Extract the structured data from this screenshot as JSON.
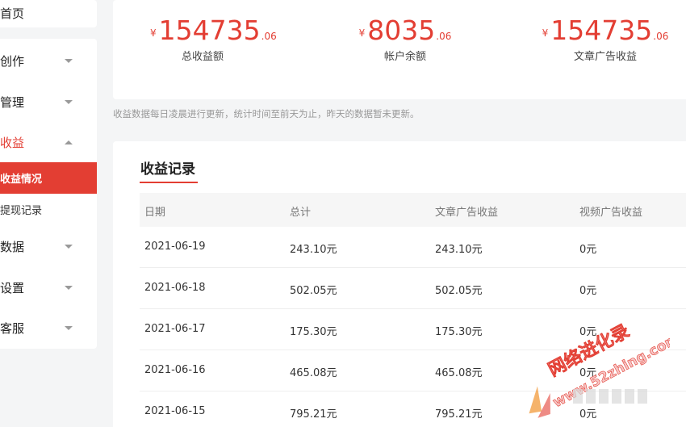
{
  "sidebar": {
    "home": "首页",
    "items": [
      {
        "label": "创作"
      },
      {
        "label": "管理"
      },
      {
        "label": "收益"
      },
      {
        "label": "数据"
      },
      {
        "label": "设置"
      },
      {
        "label": "客服"
      }
    ],
    "sub_items": [
      {
        "label": "收益情况",
        "active": true
      },
      {
        "label": "提现记录",
        "active": false
      }
    ]
  },
  "stats": [
    {
      "currency": "¥",
      "integer": "154735",
      "decimal": ".06",
      "caption": "总收益额"
    },
    {
      "currency": "¥",
      "integer": "8035",
      "decimal": ".06",
      "caption": "帐户余额"
    },
    {
      "currency": "¥",
      "integer": "154735",
      "decimal": ".06",
      "caption": "文章广告收益"
    }
  ],
  "note": "收益数据每日凌晨进行更新，统计时间至前天为止，昨天的数据暂未更新。",
  "records": {
    "title": "收益记录",
    "columns": [
      "日期",
      "总计",
      "文章广告收益",
      "视频广告收益"
    ],
    "rows": [
      [
        "2021-06-19",
        "243.10元",
        "243.10元",
        "0元"
      ],
      [
        "2021-06-18",
        "502.05元",
        "502.05元",
        "0元"
      ],
      [
        "2021-06-17",
        "175.30元",
        "175.30元",
        "0元"
      ],
      [
        "2021-06-16",
        "465.08元",
        "465.08元",
        "0元"
      ],
      [
        "2021-06-15",
        "795.21元",
        "795.21元",
        "0元"
      ]
    ]
  },
  "watermark": {
    "site": "网络进化录",
    "url": "www.52zhing.com"
  },
  "colors": {
    "accent": "#e33e33",
    "background": "#f4f5f6",
    "card": "#ffffff"
  }
}
